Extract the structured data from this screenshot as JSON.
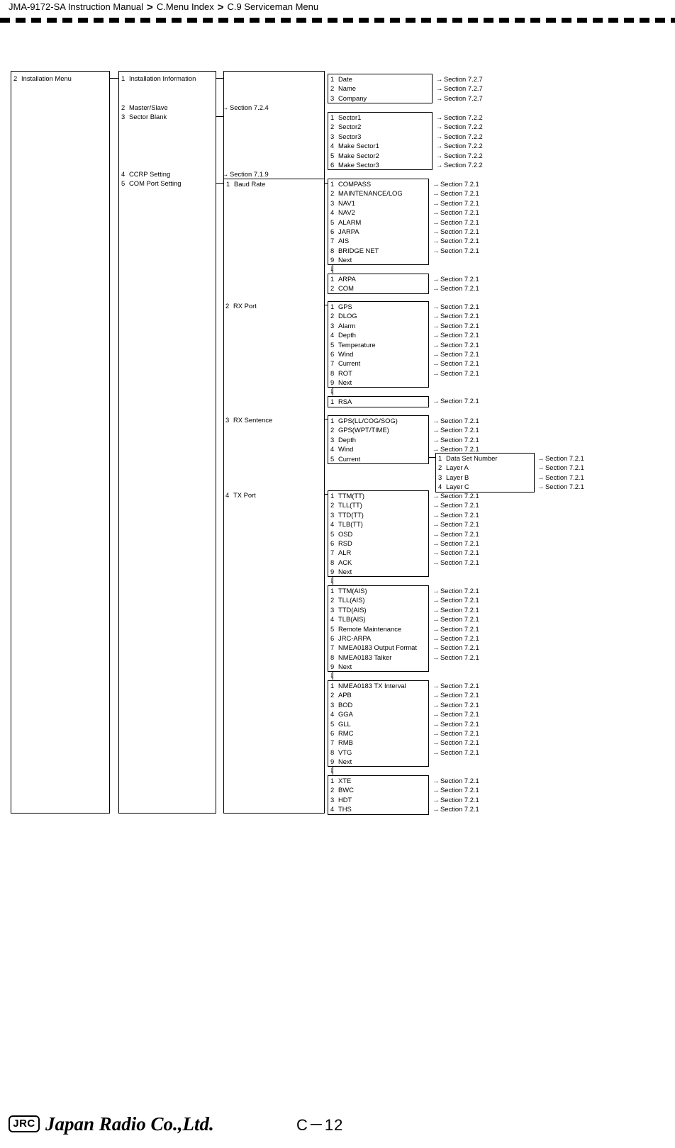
{
  "header": {
    "manual": "JMA-9172-SA Instruction Manual",
    "sep": ">",
    "crumb2": "C.Menu Index",
    "crumb3": "C.9  Serviceman Menu"
  },
  "footer": {
    "logo_text": "JRC",
    "company": "Japan Radio Co.,Ltd.",
    "page_number": "C－12"
  },
  "diagram": {
    "type": "menu-tree",
    "level1": {
      "number": "2",
      "label": "Installation Menu"
    },
    "level2": [
      {
        "number": "1",
        "label": "Installation Information"
      },
      {
        "number": "2",
        "label": "Master/Slave",
        "ref": "Section 7.2.4"
      },
      {
        "number": "3",
        "label": "Sector Blank"
      },
      {
        "number": "4",
        "label": "CCRP Setting",
        "ref": "Section 7.1.9"
      },
      {
        "number": "5",
        "label": "COM Port Setting"
      }
    ],
    "installation_information": {
      "items": [
        {
          "number": "1",
          "label": "Date",
          "ref": "Section 7.2.7"
        },
        {
          "number": "2",
          "label": "Name",
          "ref": "Section 7.2.7"
        },
        {
          "number": "3",
          "label": "Company",
          "ref": "Section 7.2.7"
        }
      ]
    },
    "sector_blank": {
      "items": [
        {
          "number": "1",
          "label": "Sector1",
          "ref": "Section 7.2.2"
        },
        {
          "number": "2",
          "label": "Sector2",
          "ref": "Section 7.2.2"
        },
        {
          "number": "3",
          "label": "Sector3",
          "ref": "Section 7.2.2"
        },
        {
          "number": "4",
          "label": "Make Sector1",
          "ref": "Section 7.2.2"
        },
        {
          "number": "5",
          "label": "Make Sector2",
          "ref": "Section 7.2.2"
        },
        {
          "number": "6",
          "label": "Make Sector3",
          "ref": "Section 7.2.2"
        }
      ]
    },
    "com_port_setting": {
      "items": [
        {
          "number": "1",
          "label": "Baud Rate"
        },
        {
          "number": "2",
          "label": "RX Port"
        },
        {
          "number": "3",
          "label": "RX Sentence"
        },
        {
          "number": "4",
          "label": "TX Port"
        }
      ]
    },
    "baud_rate": {
      "page1": [
        {
          "number": "1",
          "label": "COMPASS",
          "ref": "Section 7.2.1"
        },
        {
          "number": "2",
          "label": "MAINTENANCE/LOG",
          "ref": "Section 7.2.1"
        },
        {
          "number": "3",
          "label": "NAV1",
          "ref": "Section 7.2.1"
        },
        {
          "number": "4",
          "label": "NAV2",
          "ref": "Section 7.2.1"
        },
        {
          "number": "5",
          "label": "ALARM",
          "ref": "Section 7.2.1"
        },
        {
          "number": "6",
          "label": "JARPA",
          "ref": "Section 7.2.1"
        },
        {
          "number": "7",
          "label": "AIS",
          "ref": "Section 7.2.1"
        },
        {
          "number": "8",
          "label": "BRIDGE NET",
          "ref": "Section 7.2.1"
        },
        {
          "number": "9",
          "label": "Next"
        }
      ],
      "page2": [
        {
          "number": "1",
          "label": "ARPA",
          "ref": "Section 7.2.1"
        },
        {
          "number": "2",
          "label": "COM",
          "ref": "Section 7.2.1"
        }
      ]
    },
    "rx_port": {
      "page1": [
        {
          "number": "1",
          "label": "GPS",
          "ref": "Section 7.2.1"
        },
        {
          "number": "2",
          "label": "DLOG",
          "ref": "Section 7.2.1"
        },
        {
          "number": "3",
          "label": "Alarm",
          "ref": "Section 7.2.1"
        },
        {
          "number": "4",
          "label": "Depth",
          "ref": "Section 7.2.1"
        },
        {
          "number": "5",
          "label": "Temperature",
          "ref": "Section 7.2.1"
        },
        {
          "number": "6",
          "label": "Wind",
          "ref": "Section 7.2.1"
        },
        {
          "number": "7",
          "label": "Current",
          "ref": "Section 7.2.1"
        },
        {
          "number": "8",
          "label": "ROT",
          "ref": "Section 7.2.1"
        },
        {
          "number": "9",
          "label": "Next"
        }
      ],
      "page2": [
        {
          "number": "1",
          "label": "RSA",
          "ref": "Section 7.2.1"
        }
      ]
    },
    "rx_sentence": {
      "items": [
        {
          "number": "1",
          "label": "GPS(LL/COG/SOG)",
          "ref": "Section 7.2.1"
        },
        {
          "number": "2",
          "label": "GPS(WPT/TIME)",
          "ref": "Section 7.2.1"
        },
        {
          "number": "3",
          "label": "Depth",
          "ref": "Section 7.2.1"
        },
        {
          "number": "4",
          "label": "Wind",
          "ref": "Section 7.2.1"
        },
        {
          "number": "5",
          "label": "Current"
        }
      ],
      "current_sub": [
        {
          "number": "1",
          "label": "Data Set Number",
          "ref": "Section 7.2.1"
        },
        {
          "number": "2",
          "label": "Layer A",
          "ref": "Section 7.2.1"
        },
        {
          "number": "3",
          "label": "Layer B",
          "ref": "Section 7.2.1"
        },
        {
          "number": "4",
          "label": "Layer C",
          "ref": "Section 7.2.1"
        }
      ]
    },
    "tx_port": {
      "page1": [
        {
          "number": "1",
          "label": "TTM(TT)",
          "ref": "Section 7.2.1"
        },
        {
          "number": "2",
          "label": "TLL(TT)",
          "ref": "Section 7.2.1"
        },
        {
          "number": "3",
          "label": "TTD(TT)",
          "ref": "Section 7.2.1"
        },
        {
          "number": "4",
          "label": "TLB(TT)",
          "ref": "Section 7.2.1"
        },
        {
          "number": "5",
          "label": "OSD",
          "ref": "Section 7.2.1"
        },
        {
          "number": "6",
          "label": "RSD",
          "ref": "Section 7.2.1"
        },
        {
          "number": "7",
          "label": "ALR",
          "ref": "Section 7.2.1"
        },
        {
          "number": "8",
          "label": "ACK",
          "ref": "Section 7.2.1"
        },
        {
          "number": "9",
          "label": "Next"
        }
      ],
      "page2": [
        {
          "number": "1",
          "label": "TTM(AIS)",
          "ref": "Section 7.2.1"
        },
        {
          "number": "2",
          "label": "TLL(AIS)",
          "ref": "Section 7.2.1"
        },
        {
          "number": "3",
          "label": "TTD(AIS)",
          "ref": "Section 7.2.1"
        },
        {
          "number": "4",
          "label": "TLB(AIS)",
          "ref": "Section 7.2.1"
        },
        {
          "number": "5",
          "label": "Remote Maintenance",
          "ref": "Section 7.2.1"
        },
        {
          "number": "6",
          "label": "JRC-ARPA",
          "ref": "Section 7.2.1"
        },
        {
          "number": "7",
          "label": "NMEA0183 Output Format",
          "ref": "Section 7.2.1"
        },
        {
          "number": "8",
          "label": "NMEA0183 Talker",
          "ref": "Section 7.2.1"
        },
        {
          "number": "9",
          "label": "Next"
        }
      ],
      "page3": [
        {
          "number": "1",
          "label": "NMEA0183 TX Interval",
          "ref": "Section 7.2.1"
        },
        {
          "number": "2",
          "label": "APB",
          "ref": "Section 7.2.1"
        },
        {
          "number": "3",
          "label": "BOD",
          "ref": "Section 7.2.1"
        },
        {
          "number": "4",
          "label": "GGA",
          "ref": "Section 7.2.1"
        },
        {
          "number": "5",
          "label": "GLL",
          "ref": "Section 7.2.1"
        },
        {
          "number": "6",
          "label": "RMC",
          "ref": "Section 7.2.1"
        },
        {
          "number": "7",
          "label": "RMB",
          "ref": "Section 7.2.1"
        },
        {
          "number": "8",
          "label": "VTG",
          "ref": "Section 7.2.1"
        },
        {
          "number": "9",
          "label": "Next"
        }
      ],
      "page4": [
        {
          "number": "1",
          "label": "XTE",
          "ref": "Section 7.2.1"
        },
        {
          "number": "2",
          "label": "BWC",
          "ref": "Section 7.2.1"
        },
        {
          "number": "3",
          "label": "HDT",
          "ref": "Section 7.2.1"
        },
        {
          "number": "4",
          "label": "THS",
          "ref": "Section 7.2.1"
        }
      ]
    }
  }
}
